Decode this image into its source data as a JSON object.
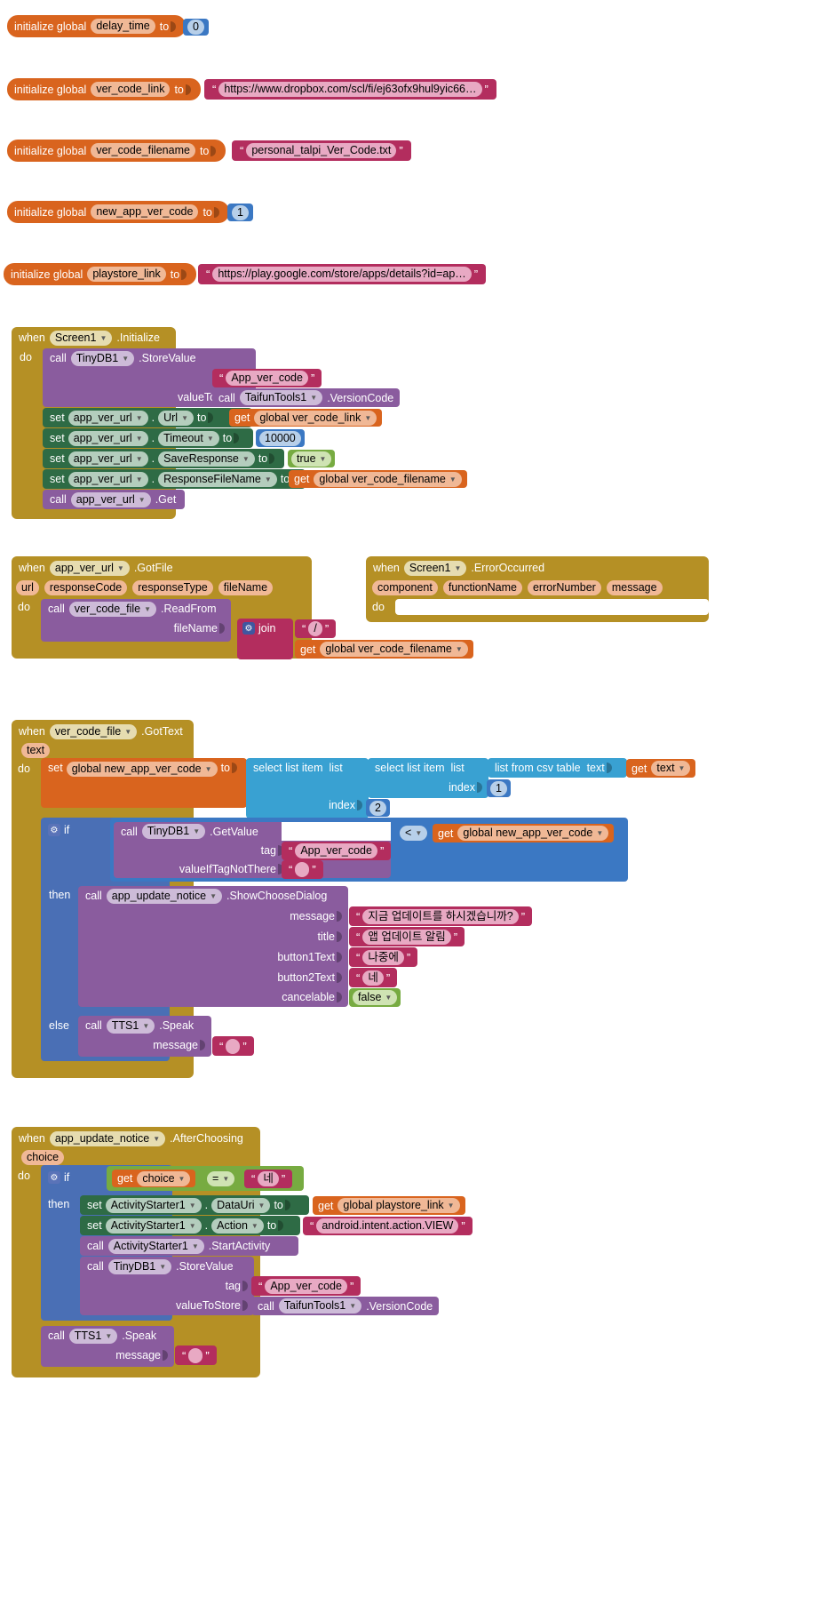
{
  "app": {
    "editor": "MIT App Inventor Blocks Editor",
    "canvas_bg": "#ffffff"
  },
  "colors": {
    "variable": "#d9641e",
    "text": "#b32d5e",
    "event": "#b59025",
    "component": "#8a5c9e",
    "setter": "#2e6b45",
    "math": "#3b78c3",
    "list": "#39a1d2",
    "logic": "#77ab41",
    "control": "#4a6fb5"
  },
  "words": {
    "initialize_global": "initialize global",
    "to": "to",
    "when": "when",
    "do": "do",
    "call": "call",
    "set": "set",
    "get": "get",
    "if": "if",
    "then": "then",
    "else": "else",
    "join": "join",
    "dot": ".",
    "text_param": "text",
    "choice_param": "choice",
    "select_list_item": "select list item",
    "list_word": "list",
    "index_word": "index",
    "list_from_csv_table": "list from csv table",
    "tag": "tag",
    "valueToStore": "valueToStore",
    "valueIfTagNotThere": "valueIfTagNotThere",
    "message": "message",
    "title": "title",
    "button1Text": "button1Text",
    "button2Text": "button2Text",
    "cancelable": "cancelable",
    "fileName": "fileName",
    "slash": "/"
  },
  "globals": [
    {
      "name": "delay_time",
      "value": "0",
      "value_type": "math"
    },
    {
      "name": "ver_code_link",
      "value": "https://www.dropbox.com/scl/fi/ej63ofx9hul9yic66…",
      "value_type": "text"
    },
    {
      "name": "ver_code_filename",
      "value": "personal_talpi_Ver_Code.txt",
      "value_type": "text"
    },
    {
      "name": "new_app_ver_code",
      "value": "1",
      "value_type": "math"
    },
    {
      "name": "playstore_link",
      "value": "https://play.google.com/store/apps/details?id=ap…",
      "value_type": "text"
    }
  ],
  "screen_initialize": {
    "event_component": "Screen1",
    "event_name": ".Initialize",
    "statements": [
      {
        "kind": "call",
        "component": "TinyDB1",
        "method": ".StoreValue",
        "args": [
          {
            "label": "tag",
            "type": "text",
            "value": "App_ver_code"
          },
          {
            "label": "valueToStore",
            "type": "call",
            "component": "TaifunTools1",
            "method": ".VersionCode"
          }
        ]
      },
      {
        "kind": "set",
        "component": "app_ver_url",
        "property": "Url",
        "value_type": "get",
        "value": "global ver_code_link"
      },
      {
        "kind": "set",
        "component": "app_ver_url",
        "property": "Timeout",
        "value_type": "math",
        "value": "10000"
      },
      {
        "kind": "set",
        "component": "app_ver_url",
        "property": "SaveResponse",
        "value_type": "logic",
        "value": "true"
      },
      {
        "kind": "set",
        "component": "app_ver_url",
        "property": "ResponseFileName",
        "value_type": "get",
        "value": "global ver_code_filename"
      },
      {
        "kind": "call",
        "component": "app_ver_url",
        "method": ".Get",
        "args": []
      }
    ]
  },
  "got_file": {
    "event_component": "app_ver_url",
    "event_name": ".GotFile",
    "params": [
      "url",
      "responseCode",
      "responseType",
      "fileName"
    ],
    "statements": [
      {
        "kind": "call",
        "component": "ver_code_file",
        "method": ".ReadFrom",
        "arg_label": "fileName",
        "join_label": "join",
        "join_items": [
          {
            "type": "text",
            "value": "/"
          },
          {
            "type": "get",
            "value": "global ver_code_filename"
          }
        ]
      }
    ]
  },
  "error_occurred": {
    "event_component": "Screen1",
    "event_name": ".ErrorOccurred",
    "params": [
      "component",
      "functionName",
      "errorNumber",
      "message"
    ],
    "statements": []
  },
  "got_text": {
    "event_component": "ver_code_file",
    "event_name": ".GotText",
    "params": [
      "text"
    ],
    "set_target": "global new_app_ver_code",
    "outer_select": {
      "label": "select list item",
      "list_word": "list",
      "index_label": "index",
      "index": "2"
    },
    "inner_select": {
      "label": "select list item",
      "list_word": "list",
      "index_label": "index",
      "index": "1"
    },
    "csv": {
      "label": "list from csv table",
      "text_label": "text",
      "get_value": "text"
    },
    "if_block": {
      "condition": {
        "left_call": {
          "component": "TinyDB1",
          "method": ".GetValue",
          "args": [
            {
              "label": "tag",
              "type": "text",
              "value": "App_ver_code"
            },
            {
              "label": "valueIfTagNotThere",
              "type": "text",
              "value": ""
            }
          ]
        },
        "operator": "<",
        "right_get": "global new_app_ver_code"
      },
      "then": [
        {
          "kind": "call",
          "component": "app_update_notice",
          "method": ".ShowChooseDialog",
          "args": [
            {
              "label": "message",
              "type": "text",
              "value": "지금 업데이트를 하시겠습니까?"
            },
            {
              "label": "title",
              "type": "text",
              "value": "앱 업데이트 알림"
            },
            {
              "label": "button1Text",
              "type": "text",
              "value": "나중에"
            },
            {
              "label": "button2Text",
              "type": "text",
              "value": "네"
            },
            {
              "label": "cancelable",
              "type": "logic",
              "value": "false"
            }
          ]
        }
      ],
      "else": [
        {
          "kind": "call",
          "component": "TTS1",
          "method": ".Speak",
          "args": [
            {
              "label": "message",
              "type": "text",
              "value": ""
            }
          ]
        }
      ]
    }
  },
  "after_choosing": {
    "event_component": "app_update_notice",
    "event_name": ".AfterChoosing",
    "params": [
      "choice"
    ],
    "if_block": {
      "condition": {
        "left_get": "choice",
        "operator": "=",
        "right_text": "네"
      },
      "then": [
        {
          "kind": "set",
          "component": "ActivityStarter1",
          "property": "DataUri",
          "value_type": "get",
          "value": "global playstore_link"
        },
        {
          "kind": "set",
          "component": "ActivityStarter1",
          "property": "Action",
          "value_type": "text",
          "value": "android.intent.action.VIEW"
        },
        {
          "kind": "call",
          "component": "ActivityStarter1",
          "method": ".StartActivity",
          "args": []
        },
        {
          "kind": "call",
          "component": "TinyDB1",
          "method": ".StoreValue",
          "args": [
            {
              "label": "tag",
              "type": "text",
              "value": "App_ver_code"
            },
            {
              "label": "valueToStore",
              "type": "call",
              "component": "TaifunTools1",
              "method": ".VersionCode"
            }
          ]
        }
      ]
    },
    "trailing": [
      {
        "kind": "call",
        "component": "TTS1",
        "method": ".Speak",
        "args": [
          {
            "label": "message",
            "type": "text",
            "value": ""
          }
        ]
      }
    ]
  }
}
